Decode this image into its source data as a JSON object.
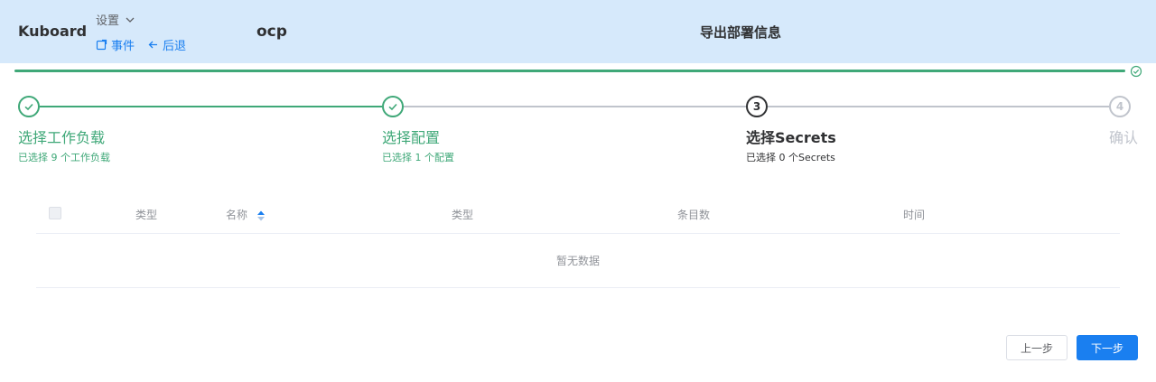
{
  "header": {
    "brand": "Kuboard",
    "settings_label": "设置",
    "events_label": "事件",
    "back_label": "后退",
    "namespace": "ocp",
    "title": "导出部署信息"
  },
  "progress": {
    "value": 1.0
  },
  "steps": [
    {
      "index": "1",
      "title": "选择工作负载",
      "desc": "已选择 9 个工作负载",
      "status": "done"
    },
    {
      "index": "2",
      "title": "选择配置",
      "desc": "已选择 1 个配置",
      "status": "done"
    },
    {
      "index": "3",
      "title": "选择Secrets",
      "desc": "已选择 0 个Secrets",
      "status": "active"
    },
    {
      "index": "4",
      "title": "确认",
      "desc": "",
      "status": "pending"
    }
  ],
  "table": {
    "columns": [
      "类型",
      "名称",
      "类型",
      "条目数",
      "时间"
    ],
    "empty_text": "暂无数据"
  },
  "buttons": {
    "prev": "上一步",
    "next": "下一步"
  },
  "colors": {
    "header_bg": "#d6e9fb",
    "success": "#3fa878",
    "primary": "#1a7ff0",
    "pending": "#c0c4cc"
  }
}
